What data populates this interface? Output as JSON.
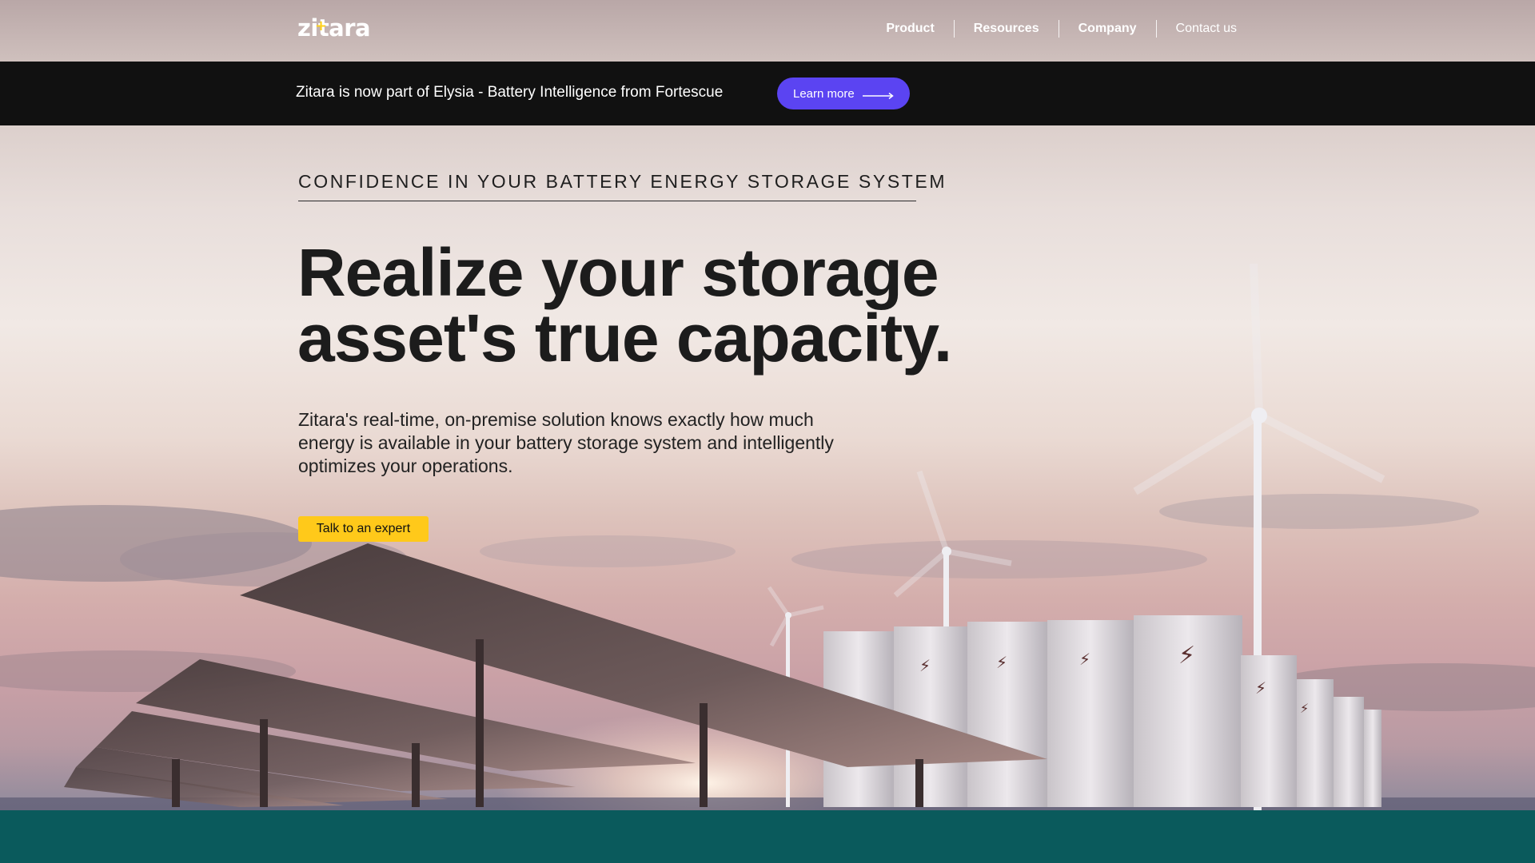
{
  "brand": {
    "logo_text": "zitara",
    "accent_color": "#ffd11a"
  },
  "nav": {
    "items": [
      {
        "label": "Product"
      },
      {
        "label": "Resources"
      },
      {
        "label": "Company"
      },
      {
        "label": "Contact us"
      }
    ]
  },
  "announcement": {
    "text": "Zitara is now part of Elysia - Battery Intelligence from Fortescue",
    "button_label": "Learn more",
    "button_color": "#5b44f2",
    "arrow_icon": "long-arrow-right-icon"
  },
  "hero": {
    "eyebrow": "CONFIDENCE IN YOUR BATTERY ENERGY STORAGE SYSTEM",
    "headline": "Realize your storage asset's true capacity.",
    "subcopy": "Zitara's real-time, on-premise solution knows exactly how much energy is available in your battery storage system and intelligently optimizes your operations.",
    "cta_label": "Talk to an expert",
    "cta_color": "#ffc91a"
  },
  "colors": {
    "announcement_bg": "#111111",
    "footer_band": "#0a5a5c"
  }
}
